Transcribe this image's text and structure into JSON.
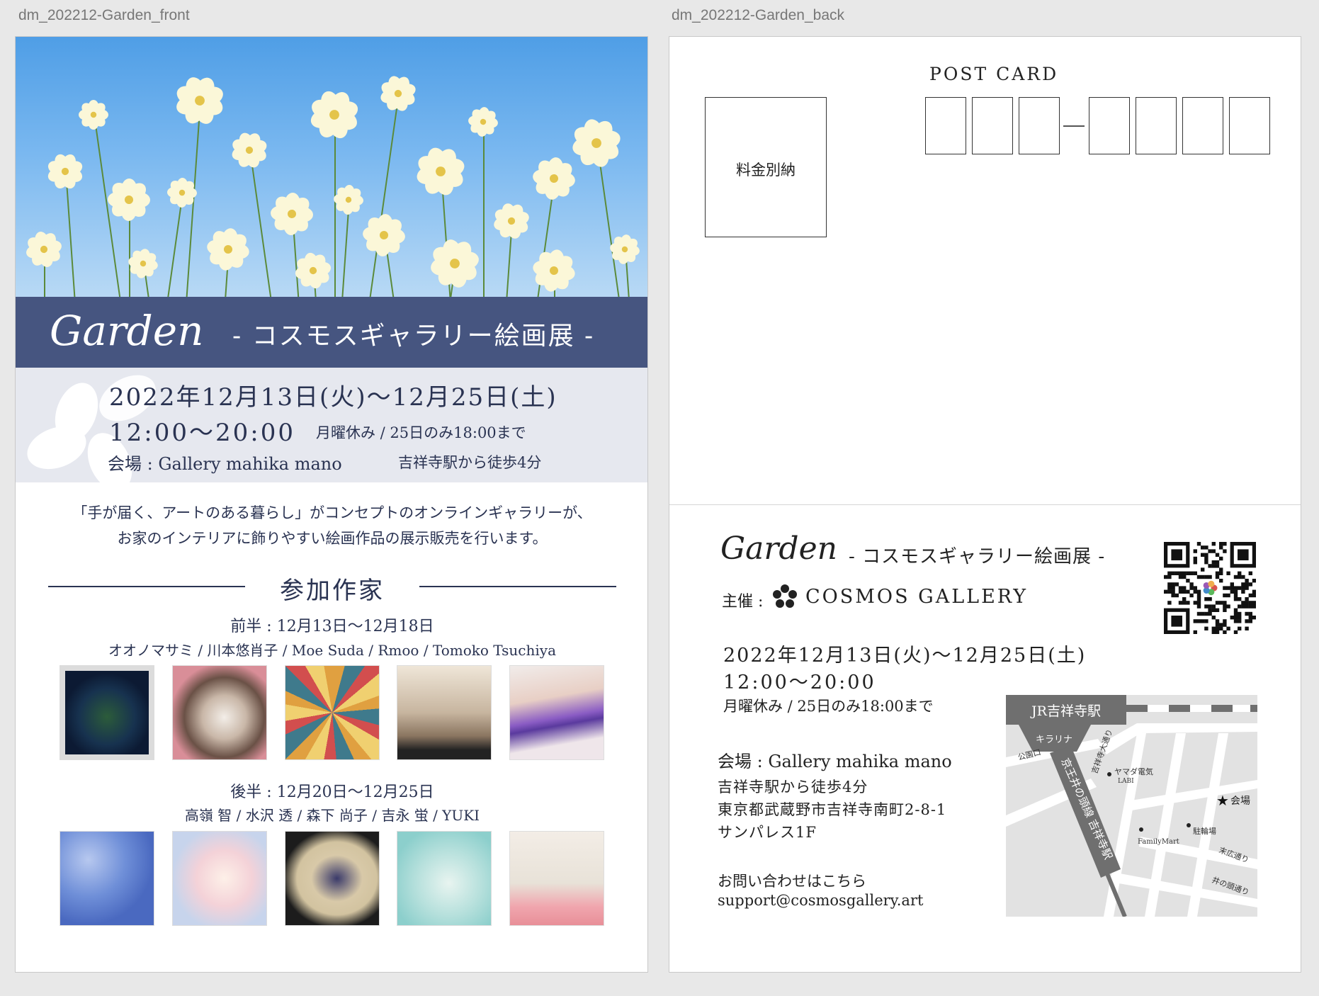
{
  "artboards": {
    "front_label": "dm_202212-Garden_front",
    "back_label": "dm_202212-Garden_back"
  },
  "front": {
    "title_script": "Garden",
    "subtitle": "- コスモスギャラリー絵画展 -",
    "date": "2022年12月13日(火)〜12月25日(土)",
    "time": "12:00〜20:00",
    "closed": "月曜休み / 25日のみ18:00まで",
    "venue": "会場 : Gallery mahika mano",
    "access": "吉祥寺駅から徒歩4分",
    "concept_line1": "「手が届く、アートのある暮らし」がコンセプトのオンラインギャラリーが、",
    "concept_line2": "お家のインテリアに飾りやすい絵画作品の展示販売を行います。",
    "section_title": "参加作家",
    "first_half": {
      "period": "前半 : 12月13日〜12月18日",
      "artists": "オオノマサミ / 川本悠肖子 / Moe Suda / Rmoo / Tomoko Tsuchiya"
    },
    "second_half": {
      "period": "後半 : 12月20日〜12月25日",
      "artists": "高嶺 智 / 水沢 透 / 森下 尚子 / 吉永 蛍 / YUKI"
    }
  },
  "back": {
    "postcard_label": "POST CARD",
    "stamp_text": "料金別納",
    "title_script": "Garden",
    "subtitle": "- コスモスギャラリー絵画展 -",
    "organizer_label": "主催 :",
    "organizer_name": "COSMOS GALLERY",
    "date": "2022年12月13日(火)〜12月25日(土)",
    "time": "12:00〜20:00",
    "closed": "月曜休み / 25日のみ18:00まで",
    "venue": "会場 : Gallery mahika mano",
    "access": "吉祥寺駅から徒歩4分",
    "address1": "東京都武蔵野市吉祥寺南町2-8-1",
    "address2": "サンパレス1F",
    "contact_label": "お問い合わせはこちら",
    "email": "support@cosmosgallery.art",
    "map": {
      "station": "JR吉祥寺駅",
      "kirarina": "キラリナ",
      "park_exit": "公園口",
      "kichijoji_dori": "吉祥寺大通り",
      "yamada1": "ヤマダ電気",
      "yamada2": "LABI",
      "keio_line": "京王井の頭線 吉祥寺駅",
      "venue": "会場",
      "familymart": "FamilyMart",
      "parking": "駐輪場",
      "suehiro": "末広通り",
      "inokashira": "井の頭通り"
    }
  }
}
